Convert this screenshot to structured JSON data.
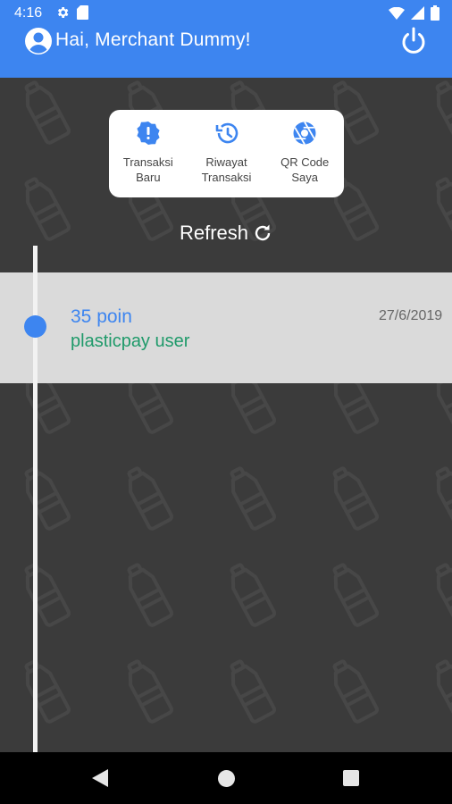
{
  "status_bar": {
    "time": "4:16"
  },
  "app_bar": {
    "greeting": "Hai, Merchant Dummy!"
  },
  "menu": {
    "items": [
      {
        "label": "Transaksi\nBaru",
        "icon": "alert-badge-icon"
      },
      {
        "label": "Riwayat\nTransaksi",
        "icon": "history-icon"
      },
      {
        "label": "QR Code\nSaya",
        "icon": "aperture-icon"
      }
    ]
  },
  "refresh": {
    "label": "Refresh"
  },
  "transactions": [
    {
      "points": "35 poin",
      "user": "plasticpay user",
      "date": "27/6/2019"
    }
  ],
  "colors": {
    "primary": "#3d85f0",
    "background": "#3b3b3b",
    "row": "#dadada",
    "user_text": "#1f9a6a"
  }
}
